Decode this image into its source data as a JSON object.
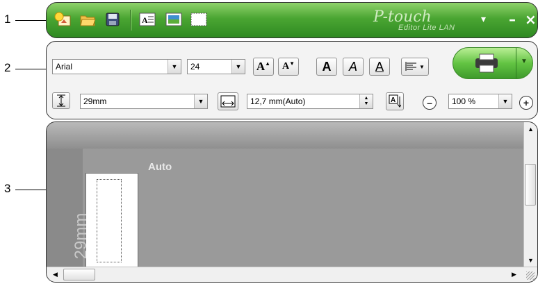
{
  "callouts": {
    "c1": "1",
    "c2": "2",
    "c3": "3"
  },
  "titlebar": {
    "brand": "P-touch",
    "brand_sub": "Editor Lite LAN",
    "icons": [
      "new-label-icon",
      "open-folder-icon",
      "save-icon",
      "insert-text-icon",
      "insert-frame-icon",
      "insert-image-icon"
    ],
    "window_buttons": {
      "dropdown": "▾",
      "minimize": "–",
      "close": "×"
    }
  },
  "ribbon": {
    "font": {
      "value": "Arial"
    },
    "size": {
      "value": "24"
    },
    "tape": {
      "value": "29mm"
    },
    "length": {
      "value": "12,7 mm(Auto)"
    },
    "zoom": {
      "value": "100 %"
    },
    "buttons": {
      "grow": "A",
      "shrink": "A",
      "bold": "A",
      "italic": "A",
      "underline": "A"
    }
  },
  "canvas": {
    "tape_length_label": "29mm",
    "auto_label": "Auto"
  },
  "colors": {
    "titlebar_green": "#4aa532",
    "print_green": "#63c443",
    "canvas_gray": "#9a9a9a"
  }
}
